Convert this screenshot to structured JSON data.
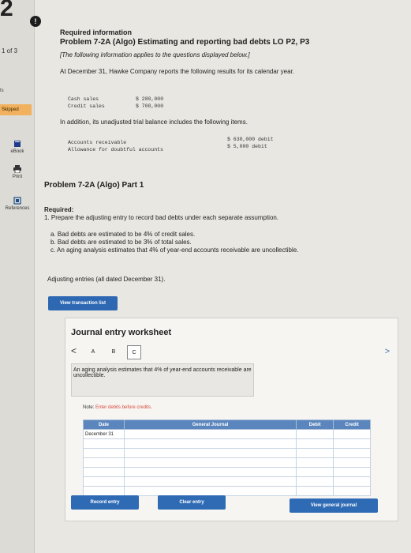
{
  "sidebar": {
    "question_number": "2",
    "progress": "1 of 3",
    "points_label": "ts",
    "skipped_label": "Skipped",
    "items": [
      {
        "label": "eBook",
        "icon": "book-icon"
      },
      {
        "label": "Print",
        "icon": "print-icon"
      },
      {
        "label": "References",
        "icon": "references-icon"
      }
    ]
  },
  "alert_icon": "!",
  "info": {
    "heading": "Required information",
    "problem_title": "Problem 7-2A (Algo) Estimating and reporting bad debts LO P2, P3",
    "note": "[The following information applies to the questions displayed below.]",
    "intro": "At December 31, Hawke Company reports the following results for its calendar year.",
    "sales": [
      {
        "label": "Cash sales",
        "value": "$ 280,000"
      },
      {
        "label": "Credit sales",
        "value": "$ 700,000"
      }
    ],
    "addition": "In addition, its unadjusted trial balance includes the following items.",
    "trial_balance": [
      {
        "label": "Accounts receivable",
        "value": "$ 630,000 debit"
      },
      {
        "label": "Allowance for doubtful accounts",
        "value": "$ 5,000 debit"
      }
    ]
  },
  "part": {
    "title": "Problem 7-2A (Algo) Part 1",
    "required_label": "Required:",
    "required_text": "1. Prepare the adjusting entry to record bad debts under each separate assumption.",
    "assumptions": [
      "a. Bad debts are estimated to be 4% of credit sales.",
      "b. Bad debts are estimated to be 3% of total sales.",
      "c. An aging analysis estimates that 4% of year-end accounts receivable are uncollectible."
    ],
    "adjusting_note": "Adjusting entries (all dated December 31).",
    "view_transaction_button": "View transaction list"
  },
  "worksheet": {
    "title": "Journal entry worksheet",
    "tabs": [
      "A",
      "B",
      "C"
    ],
    "active_tab": "C",
    "description": "An aging analysis estimates that 4% of year-end accounts receivable are uncollectible.",
    "note_prefix": "Note: ",
    "note_text": "Enter debits before credits.",
    "columns": {
      "date": "Date",
      "general_journal": "General Journal",
      "debit": "Debit",
      "credit": "Credit"
    },
    "rows": [
      {
        "date": "December 31"
      },
      {
        "date": ""
      },
      {
        "date": ""
      },
      {
        "date": ""
      },
      {
        "date": ""
      },
      {
        "date": ""
      },
      {
        "date": ""
      }
    ],
    "record_button": "Record entry",
    "clear_button": "Clear entry",
    "view_journal_button": "View general journal"
  }
}
